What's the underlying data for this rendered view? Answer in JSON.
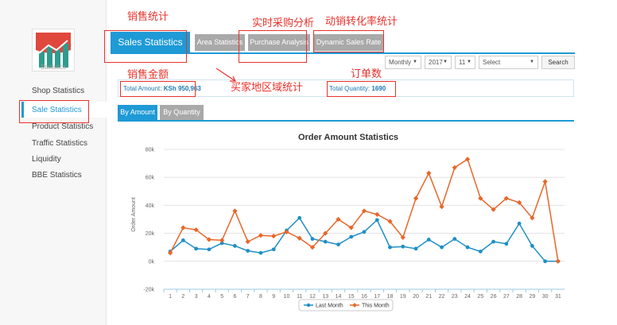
{
  "sidebar": {
    "logo_label": "Statistics",
    "items": [
      {
        "label": "Shop Statistics"
      },
      {
        "label": "Sale Statistics"
      },
      {
        "label": "Product Statistics"
      },
      {
        "label": "Traffic Statistics"
      },
      {
        "label": "Liquidity"
      },
      {
        "label": "BBE Statistics"
      }
    ],
    "active_index": 1
  },
  "tabs": {
    "main": "Sales Statistics",
    "area": "Area Statistics",
    "purchase": "Purchase Analysis",
    "dynamic": "Dynamic Sales Rate"
  },
  "filters": {
    "period": "Monthly",
    "year": "2017",
    "month": "11",
    "select": "Select",
    "search_label": "Search"
  },
  "totals": {
    "amount_label": "Total Amount:",
    "amount_value": "KSh 950,963",
    "quantity_label": "Total Quantity:",
    "quantity_value": "1690"
  },
  "sub_tabs": {
    "by_amount": "By Amount",
    "by_quantity": "By Quantity"
  },
  "annotations": {
    "sales_stats": "销售统计",
    "realtime_purchase": "实时采购分析",
    "dynamic_rate": "动销转化率统计",
    "sales_amount": "销售金额",
    "order_count": "订单数",
    "buyer_region": "买家地区域统计",
    "color": "#e8322c"
  },
  "colors": {
    "accent": "#1e9ad6",
    "tab_gray": "#a9a9a9",
    "last_month": "#1f8fc6",
    "this_month": "#e8662a"
  },
  "chart_data": {
    "type": "line",
    "title": "Order Amount Statistics",
    "ylabel": "Order Amount",
    "xlabel": "",
    "ylim": [
      -20000,
      80000
    ],
    "yticks": [
      {
        "value": -20000,
        "label": "-20k"
      },
      {
        "value": 0,
        "label": "0k"
      },
      {
        "value": 20000,
        "label": "20k"
      },
      {
        "value": 40000,
        "label": "40k"
      },
      {
        "value": 60000,
        "label": "60k"
      },
      {
        "value": 80000,
        "label": "80k"
      }
    ],
    "x": [
      1,
      2,
      3,
      4,
      5,
      6,
      7,
      8,
      9,
      10,
      11,
      12,
      13,
      14,
      15,
      16,
      17,
      18,
      19,
      20,
      21,
      22,
      23,
      24,
      25,
      26,
      27,
      28,
      29,
      30,
      31
    ],
    "grid": "horizontal",
    "legend_position": "bottom-center",
    "series": [
      {
        "name": "Last Month",
        "color": "#1f8fc6",
        "values": [
          7000,
          15000,
          9000,
          8500,
          13000,
          11000,
          7500,
          6000,
          8500,
          22000,
          31000,
          16000,
          14000,
          12000,
          17500,
          21000,
          29500,
          10000,
          10500,
          9000,
          15500,
          10000,
          16000,
          10000,
          7000,
          14000,
          12500,
          27000,
          11000,
          0,
          0
        ]
      },
      {
        "name": "This Month",
        "color": "#e8662a",
        "values": [
          6000,
          24000,
          22500,
          15500,
          15000,
          36000,
          14000,
          18500,
          18000,
          21000,
          16500,
          10000,
          20000,
          30000,
          24000,
          36000,
          33500,
          28500,
          17000,
          45000,
          63000,
          39000,
          67000,
          73000,
          45000,
          37000,
          45000,
          42000,
          31000,
          57000,
          0
        ]
      }
    ]
  }
}
